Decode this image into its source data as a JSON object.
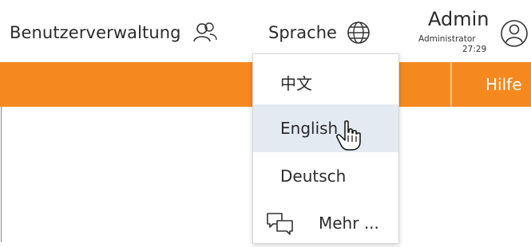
{
  "header": {
    "user_management_label": "Benutzerverwaltung",
    "language_label": "Sprache",
    "admin_name": "Admin",
    "admin_role": "Administrator",
    "session_time": "27:29"
  },
  "toolbar": {
    "help_label": "Hilfe",
    "accent_color": "#f5891f"
  },
  "language_menu": {
    "items": [
      {
        "label": "中文"
      },
      {
        "label": "English"
      },
      {
        "label": "Deutsch"
      }
    ],
    "more_label": "Mehr ..."
  },
  "icons": {
    "user_management": "users-icon",
    "language": "globe-icon",
    "profile": "user-circle-icon",
    "more": "chat-bubbles-icon",
    "pointer": "hand-pointer-icon"
  }
}
